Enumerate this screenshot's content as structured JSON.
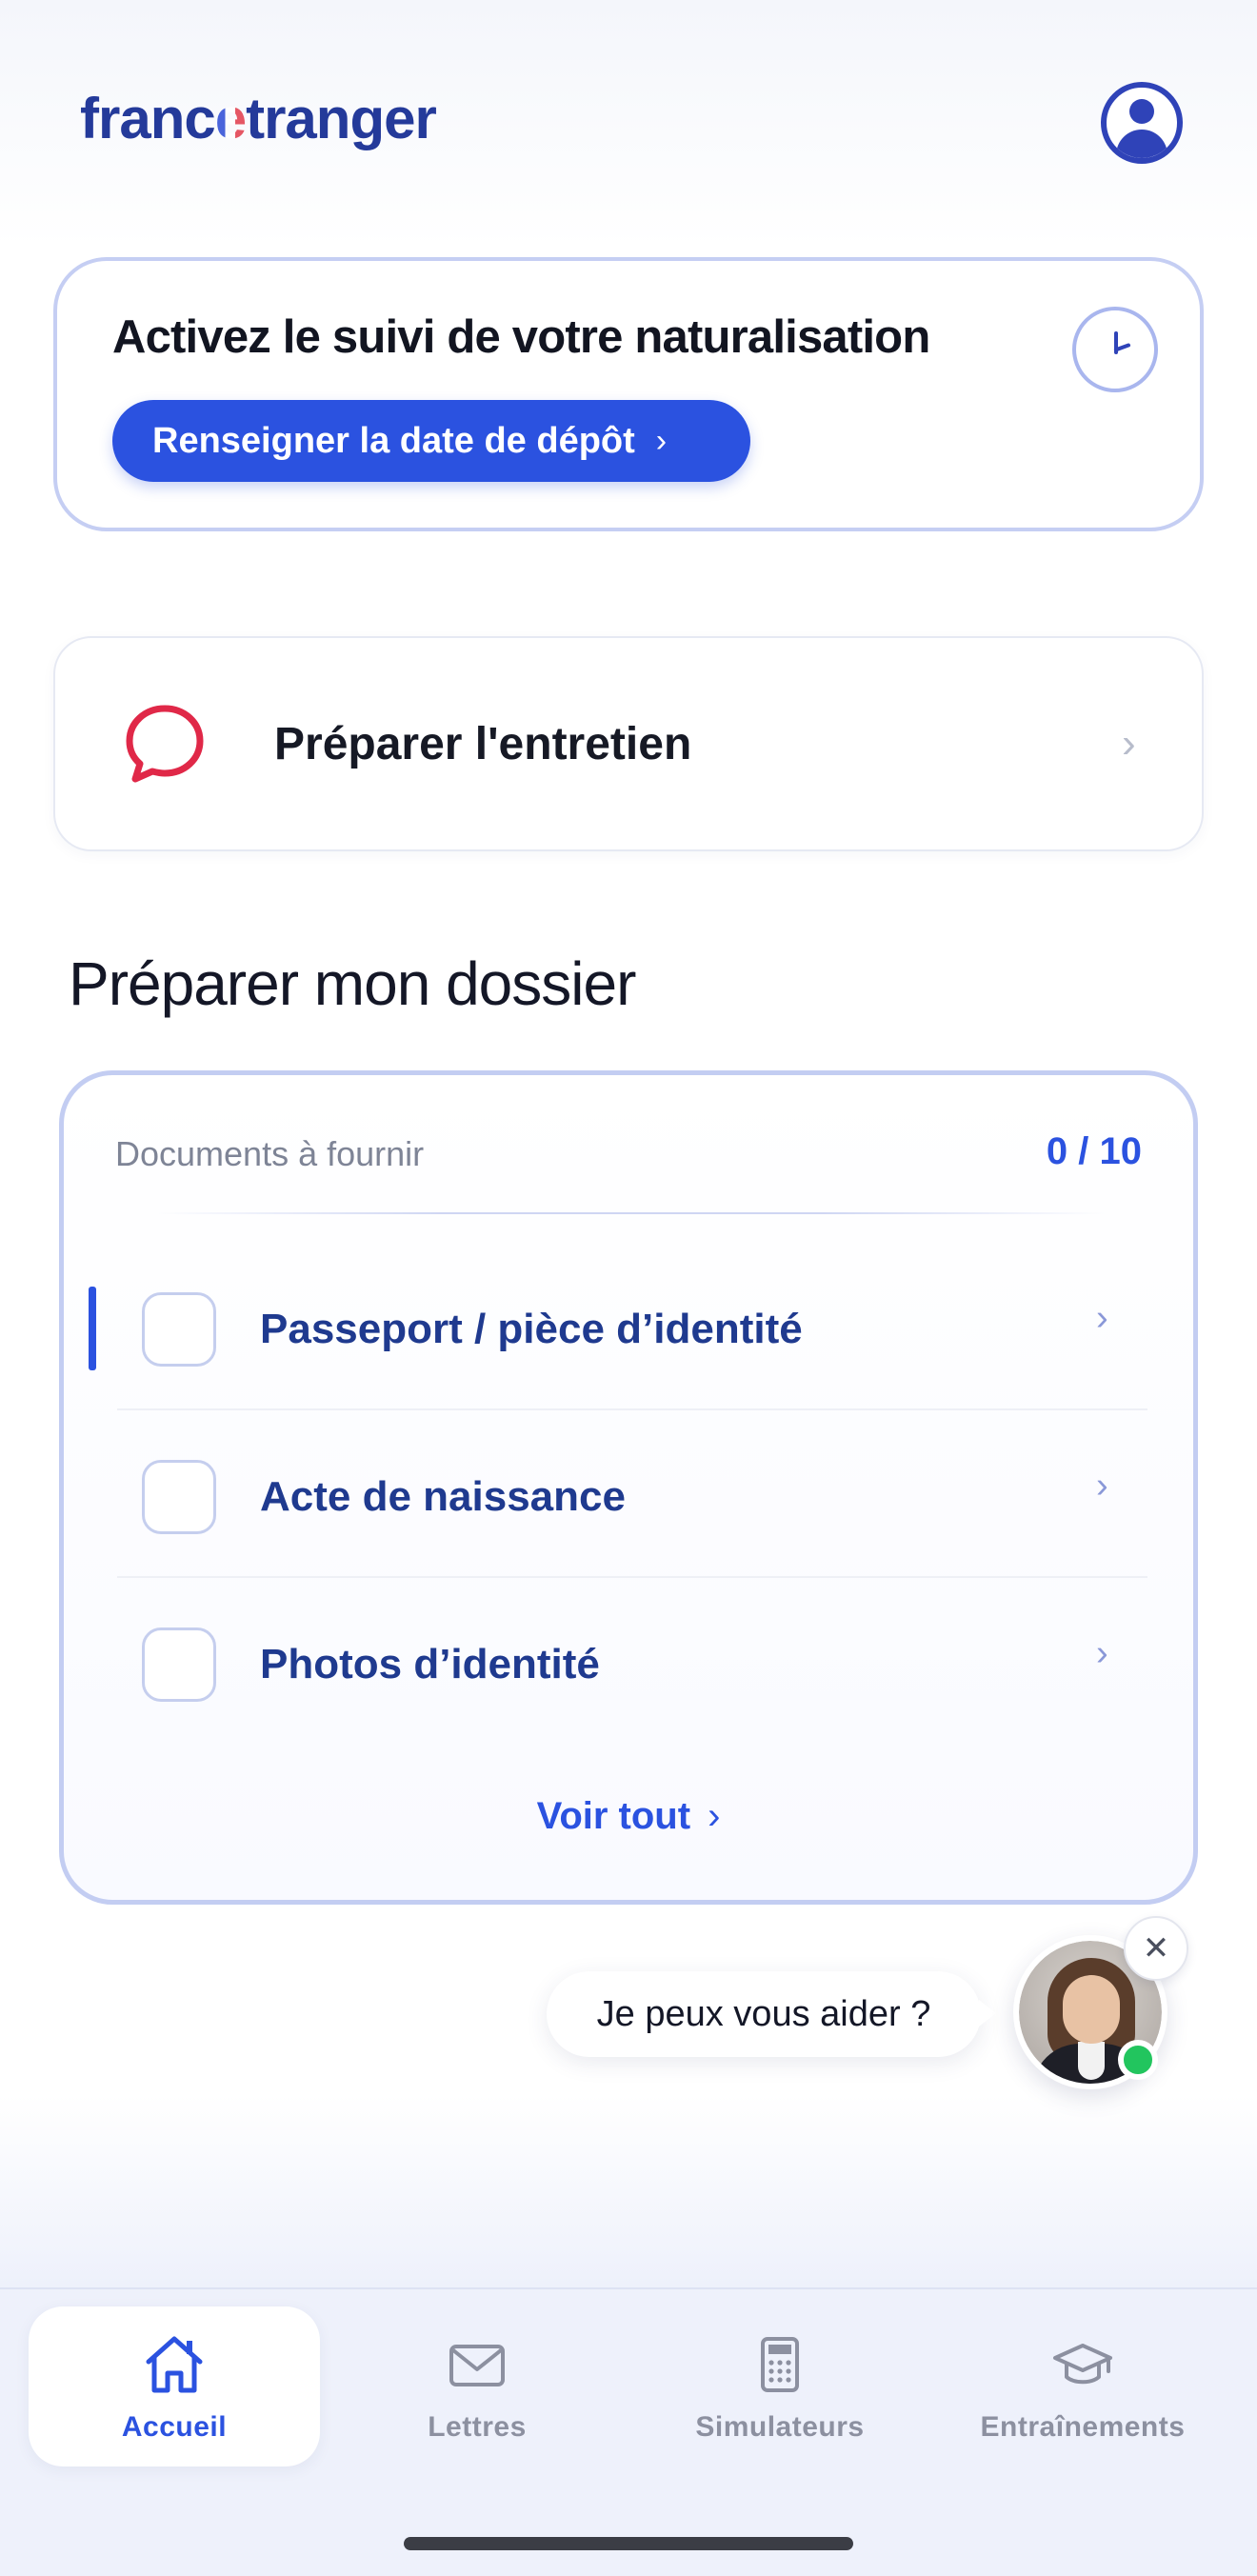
{
  "header": {
    "logo_part1": "franc",
    "logo_e": "e",
    "logo_part2": "tranger"
  },
  "naturalisation_card": {
    "title": "Activez le suivi de votre naturalisation",
    "button_label": "Renseigner la date de dépôt",
    "button_chevron": "›"
  },
  "entretien_card": {
    "label": "Préparer l'entretien",
    "chevron": "›"
  },
  "section": {
    "title": "Préparer mon dossier"
  },
  "documents": {
    "header_label": "Documents à fournir",
    "count": "0 / 10",
    "items": [
      {
        "label": "Passeport / pièce d’identité",
        "chevron": "›"
      },
      {
        "label": "Acte de naissance",
        "chevron": "›"
      },
      {
        "label": "Photos d’identité",
        "chevron": "›"
      }
    ],
    "see_all": "Voir tout",
    "see_all_chevron": "›"
  },
  "assistant": {
    "bubble_text": "Je peux vous aider ?",
    "close_icon": "✕"
  },
  "bottom_nav": {
    "items": [
      {
        "label": "Accueil",
        "icon": "home-icon",
        "active": true
      },
      {
        "label": "Lettres",
        "icon": "envelope-icon",
        "active": false
      },
      {
        "label": "Simulateurs",
        "icon": "calculator-icon",
        "active": false
      },
      {
        "label": "Entraînements",
        "icon": "graduation-cap-icon",
        "active": false
      }
    ]
  },
  "colors": {
    "primary": "#2b52e0",
    "brand_dark": "#243a9a",
    "chat_icon": "#e02848",
    "online": "#22c55e"
  }
}
